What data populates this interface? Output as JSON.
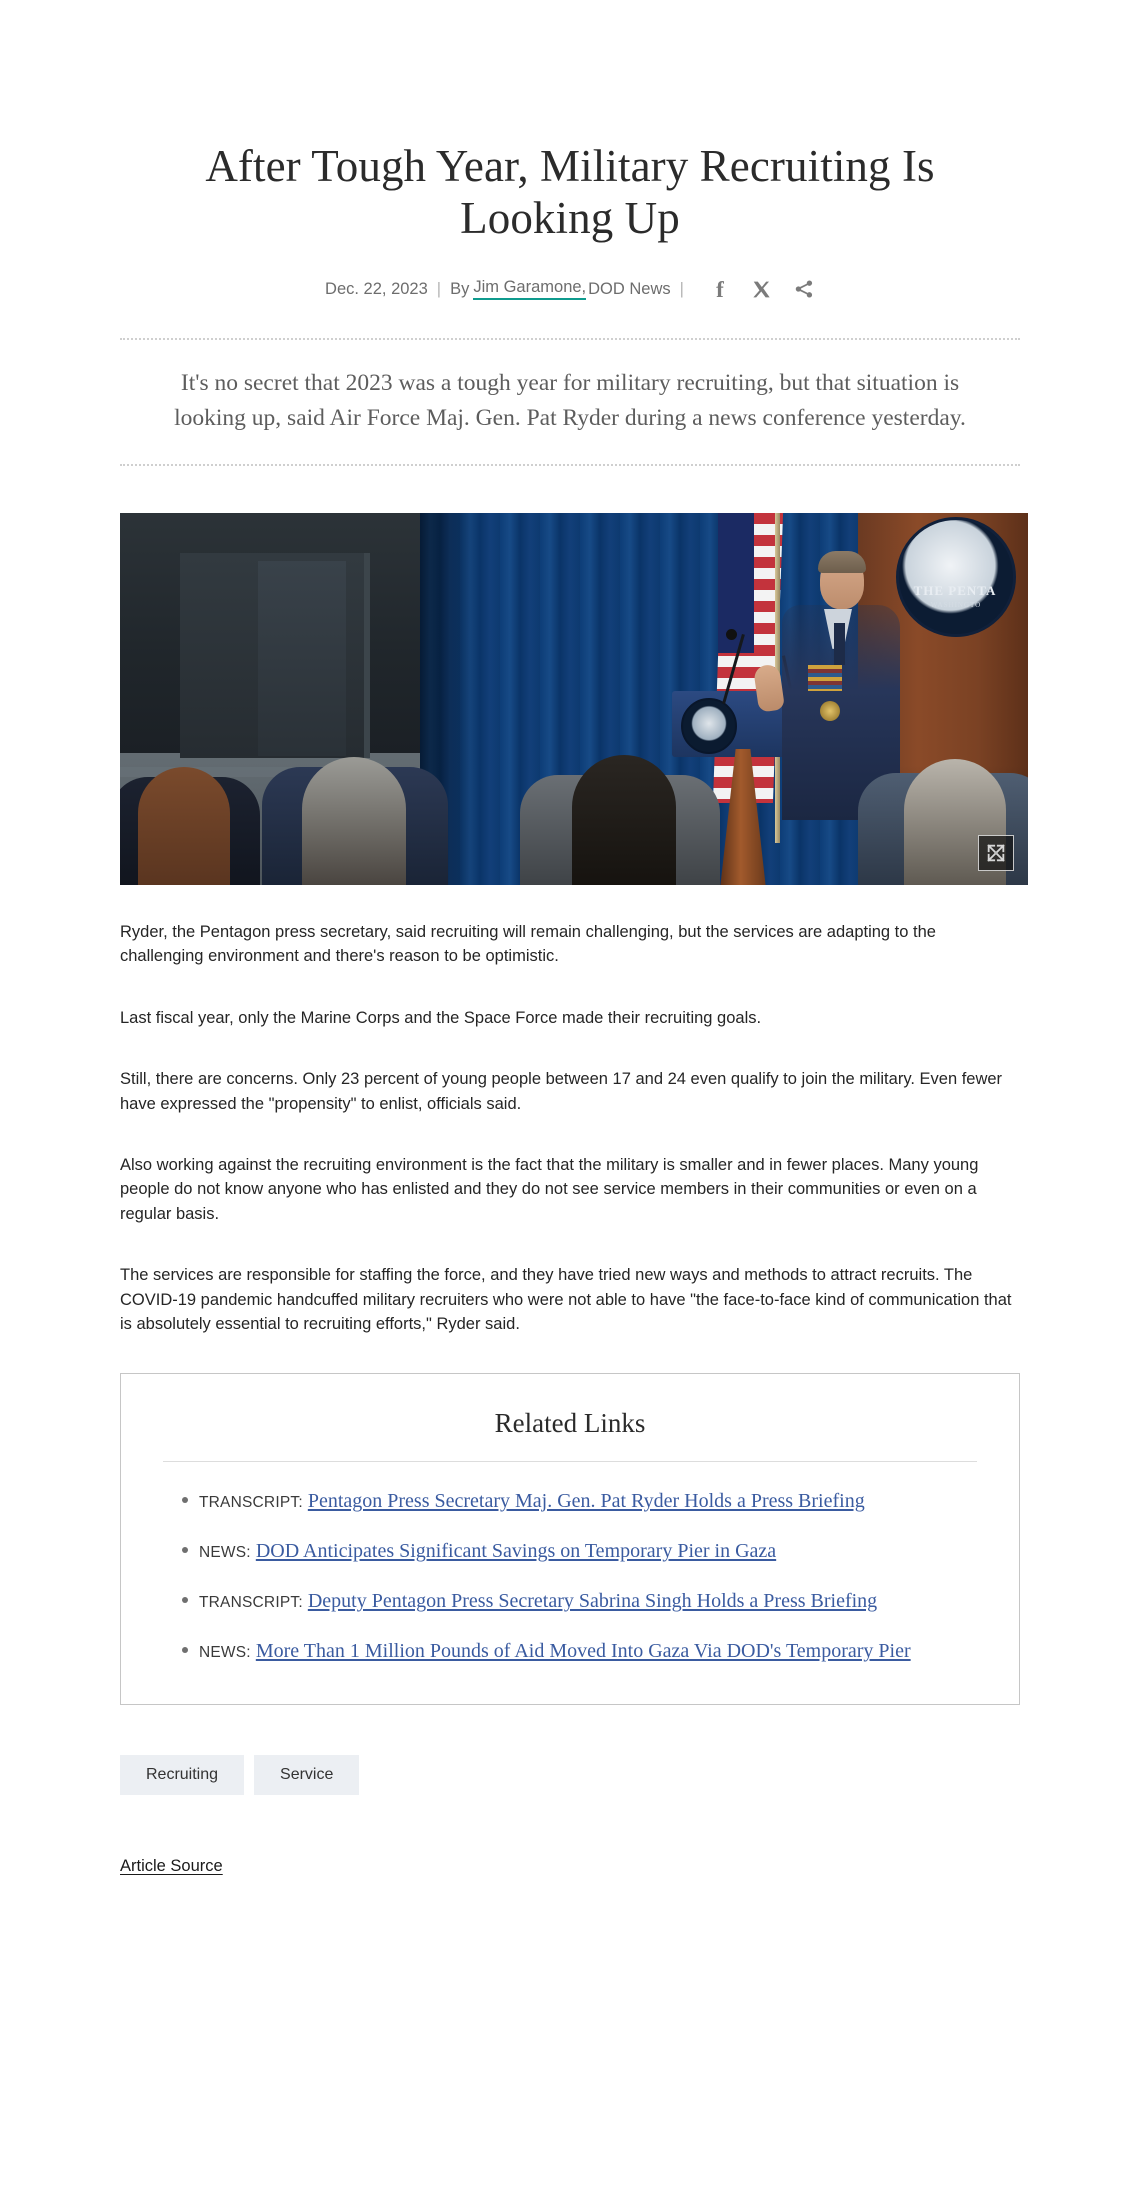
{
  "article": {
    "title": "After Tough Year, Military Recruiting Is Looking Up",
    "byline": {
      "date": "Dec. 22, 2023",
      "separator": "|",
      "by_label": "By",
      "author": "Jim Garamone,",
      "outlet": "DOD News",
      "separator2": "|"
    },
    "social": [
      {
        "name": "facebook-icon",
        "glyph": "f"
      },
      {
        "name": "x-twitter-icon",
        "glyph": "X"
      },
      {
        "name": "share-icon",
        "glyph": "share"
      }
    ],
    "lede": "It's no secret that 2023 was a tough year for military recruiting, but that situation is looking up, said Air Force Maj. Gen. Pat Ryder during a news conference yesterday.",
    "photo": {
      "alt": "Air Force Maj. Gen. Pat Ryder speaks at a podium in the Pentagon briefing room before seated reporters.",
      "expand_button_name": "expand-image-button",
      "seal_text": "THE PENTA",
      "seal_subtext": "WASHINGTO"
    },
    "paragraphs": [
      "Ryder, the Pentagon press secretary, said recruiting will remain challenging, but the services are adapting to the challenging environment and there's reason to be optimistic.",
      "Last fiscal year, only the Marine Corps and the Space Force made their recruiting goals.",
      "Still, there are concerns. Only 23 percent of young people between 17 and 24 even qualify to join the military. Even fewer have expressed the \"propensity\" to enlist, officials said.",
      "Also working against the recruiting environment is the fact that the military is smaller and in fewer places. Many young people do not know anyone who has enlisted and they do not see service members in their communities or even on a regular basis.",
      "The services are responsible for staffing the force, and they have tried new ways and methods to attract recruits. The COVID-19 pandemic handcuffed military recruiters who were not able to have \"the face-to-face kind of communication that is absolutely essential to recruiting efforts,\" Ryder said."
    ],
    "related_links": {
      "heading": "Related Links",
      "items": [
        {
          "kicker": "TRANSCRIPT:",
          "label": "Pentagon Press Secretary Maj. Gen. Pat Ryder Holds a Press Briefing"
        },
        {
          "kicker": "NEWS:",
          "label": "DOD Anticipates Significant Savings on Temporary Pier in Gaza"
        },
        {
          "kicker": "TRANSCRIPT:",
          "label": "Deputy Pentagon Press Secretary Sabrina Singh Holds a Press Briefing"
        },
        {
          "kicker": "NEWS:",
          "label": "More Than 1 Million Pounds of Aid Moved Into Gaza Via DOD's Temporary Pier"
        }
      ]
    },
    "tags": [
      {
        "label": "Recruiting"
      },
      {
        "label": "Service"
      }
    ],
    "source_link": "Article Source"
  },
  "colors": {
    "author_underline": "#0f9b8e",
    "link_blue": "#3a5ba0",
    "tag_background": "#eceff3",
    "body_text": "#252525",
    "muted_text": "#6d6d6d"
  }
}
